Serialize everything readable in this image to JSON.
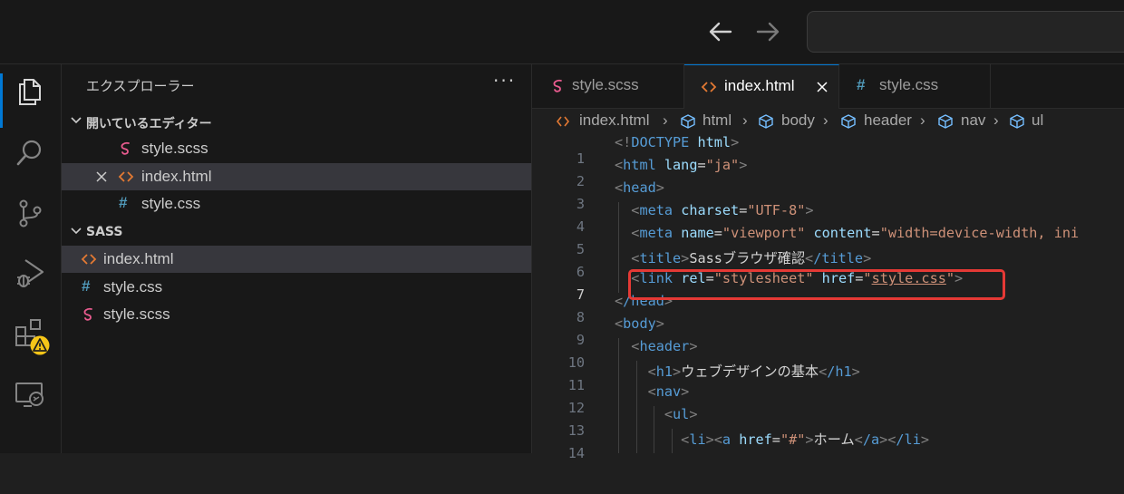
{
  "colors": {
    "accent": "#0078d4",
    "highlight": "#e53935",
    "warning": "#f5c518"
  },
  "sidebar": {
    "title": "エクスプローラー",
    "more_label": "···",
    "open_editors": {
      "header": "開いているエディター",
      "items": [
        {
          "name": "style.scss",
          "icon": "sass-file-icon"
        },
        {
          "name": "index.html",
          "icon": "html-file-icon"
        },
        {
          "name": "style.css",
          "icon": "css-file-icon",
          "icon_glyph": "#"
        }
      ]
    },
    "folder": {
      "header": "SASS",
      "items": [
        {
          "name": "index.html",
          "icon": "html-file-icon"
        },
        {
          "name": "style.css",
          "icon": "css-file-icon",
          "icon_glyph": "#"
        },
        {
          "name": "style.scss",
          "icon": "sass-file-icon"
        }
      ]
    }
  },
  "tabs": [
    {
      "label": "style.scss",
      "icon": "sass-file-icon"
    },
    {
      "label": "index.html",
      "icon": "html-file-icon"
    },
    {
      "label": "style.css",
      "icon": "css-file-icon",
      "icon_glyph": "#"
    }
  ],
  "breadcrumb": [
    "index.html",
    "html",
    "body",
    "header",
    "nav",
    "ul"
  ],
  "breadcrumb_sep": "›",
  "line_numbers": [
    "1",
    "2",
    "3",
    "4",
    "5",
    "6",
    "7",
    "8",
    "9",
    "10",
    "11",
    "12",
    "13",
    "14"
  ],
  "code": {
    "l1": {
      "open": "<",
      "bang": "!",
      "doctype": "DOCTYPE",
      "html": "html",
      "close": ">"
    },
    "l2": {
      "tag": "html",
      "attr": "lang",
      "eq": "=",
      "val": "\"ja\""
    },
    "l3": {
      "tag": "head"
    },
    "l4": {
      "tag": "meta",
      "attr": "charset",
      "eq": "=",
      "val": "\"UTF-8\""
    },
    "l5": {
      "tag": "meta",
      "attr1": "name",
      "val1": "\"viewport\"",
      "attr2": "content",
      "val2": "\"width=device-width, ini"
    },
    "l6": {
      "tag": "title",
      "text": "Sassブラウザ確認",
      "end": "/title"
    },
    "l7": {
      "tag": "link",
      "attr1": "rel",
      "val1": "\"stylesheet\"",
      "attr2": "href",
      "q": "\"",
      "link": "style.css"
    },
    "l8": {
      "tag": "/head"
    },
    "l9": {
      "tag": "body"
    },
    "l10": {
      "tag": "header"
    },
    "l11": {
      "tag": "h1",
      "text": "ウェブデザインの基本",
      "end": "/h1"
    },
    "l12": {
      "tag": "nav"
    },
    "l13": {
      "tag": "ul"
    },
    "l14": {
      "li": "li",
      "a": "a",
      "attr": "href",
      "val": "\"#\"",
      "text": "ホーム",
      "end_a": "/a",
      "end_li": "/li"
    }
  }
}
